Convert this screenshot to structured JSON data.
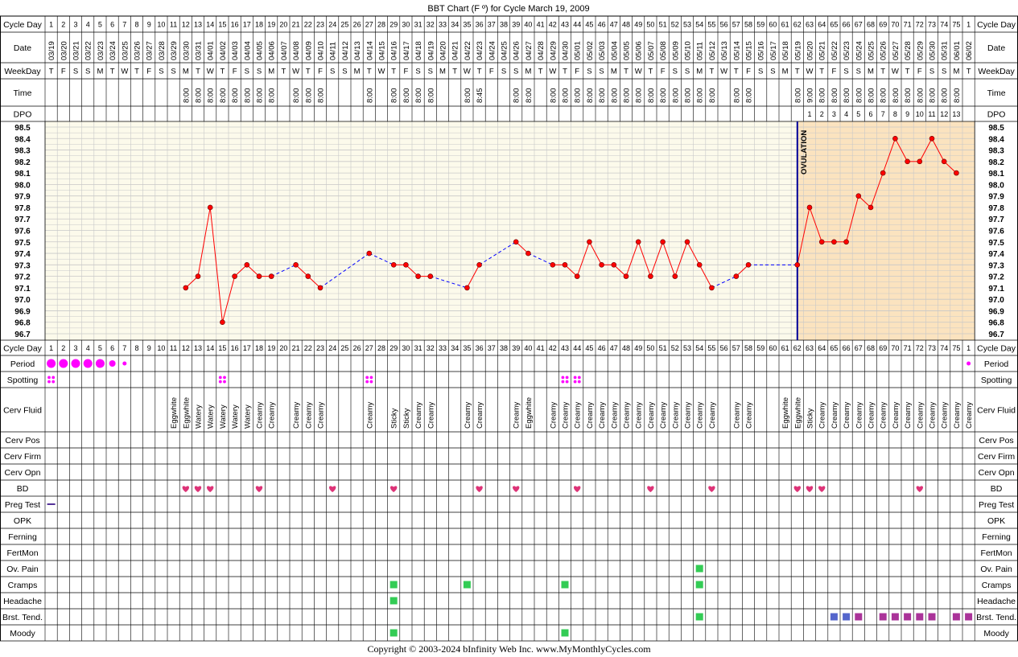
{
  "title": "BBT Chart (F º) for Cycle March 19, 2009",
  "footer": "Copyright © 2003-2024 bInfinity Web Inc.     www.MyMonthlyCycles.com",
  "row_labels": {
    "cycle_day": "Cycle Day",
    "date": "Date",
    "weekday": "WeekDay",
    "time": "Time",
    "dpo": "DPO",
    "period": "Period",
    "spotting": "Spotting",
    "cerv_fluid": "Cerv Fluid",
    "cerv_pos": "Cerv Pos",
    "cerv_firm": "Cerv Firm",
    "cerv_opn": "Cerv Opn",
    "bd": "BD",
    "preg_test": "Preg Test",
    "opk": "OPK",
    "ferning": "Ferning",
    "fertmon": "FertMon",
    "ov_pain": "Ov. Pain",
    "cramps": "Cramps",
    "headache": "Headache",
    "brst_tend": "Brst. Tend.",
    "moody": "Moody"
  },
  "ovulation_label": "OVULATION",
  "colors": {
    "line": "#ff0000",
    "point": "#ff0000",
    "dashed": "#0000ff",
    "ovulation": "#000099",
    "period": "#ff00ff",
    "bd": "#dd3377",
    "green": "#33cc55",
    "blue": "#5566cc",
    "purple": "#aa3399",
    "bg_pre": "#fcfaeb",
    "bg_post": "#fbe3bf",
    "grid": "#c8c8c8"
  },
  "chart_data": {
    "type": "line",
    "title": "BBT Chart (F º) for Cycle March 19, 2009",
    "ylim": [
      96.7,
      98.5
    ],
    "y_ticks": [
      "98.5",
      "98.4",
      "98.3",
      "98.2",
      "98.1",
      "98.0",
      "97.9",
      "97.8",
      "97.7",
      "97.6",
      "97.5",
      "97.4",
      "97.3",
      "97.2",
      "97.1",
      "97.0",
      "96.9",
      "96.8",
      "96.7"
    ],
    "cycle_days": [
      1,
      2,
      3,
      4,
      5,
      6,
      7,
      8,
      9,
      10,
      11,
      12,
      13,
      14,
      15,
      16,
      17,
      18,
      19,
      20,
      21,
      22,
      23,
      24,
      25,
      26,
      27,
      28,
      29,
      30,
      31,
      32,
      33,
      34,
      35,
      36,
      37,
      38,
      39,
      40,
      41,
      42,
      43,
      44,
      45,
      46,
      47,
      48,
      49,
      50,
      51,
      52,
      53,
      54,
      55,
      56,
      57,
      58,
      59,
      60,
      61,
      62,
      63,
      64,
      65,
      66,
      67,
      68,
      69,
      70,
      71,
      72,
      73,
      74,
      75,
      1
    ],
    "dates": [
      "03/19",
      "03/20",
      "03/21",
      "03/22",
      "03/23",
      "03/24",
      "03/25",
      "03/26",
      "03/27",
      "03/28",
      "03/29",
      "03/30",
      "03/31",
      "04/01",
      "04/02",
      "04/03",
      "04/04",
      "04/05",
      "04/06",
      "04/07",
      "04/08",
      "04/09",
      "04/10",
      "04/11",
      "04/12",
      "04/13",
      "04/14",
      "04/15",
      "04/16",
      "04/17",
      "04/18",
      "04/19",
      "04/20",
      "04/21",
      "04/22",
      "04/23",
      "04/24",
      "04/25",
      "04/26",
      "04/27",
      "04/28",
      "04/29",
      "04/30",
      "05/01",
      "05/02",
      "05/03",
      "05/04",
      "05/05",
      "05/06",
      "05/07",
      "05/08",
      "05/09",
      "05/10",
      "05/11",
      "05/12",
      "05/13",
      "05/14",
      "05/15",
      "05/16",
      "05/17",
      "05/18",
      "05/19",
      "05/20",
      "05/21",
      "05/22",
      "05/23",
      "05/24",
      "05/25",
      "05/26",
      "05/27",
      "05/28",
      "05/29",
      "05/30",
      "05/31",
      "06/01",
      "06/02"
    ],
    "weekdays": [
      "T",
      "F",
      "S",
      "S",
      "M",
      "T",
      "W",
      "T",
      "F",
      "S",
      "S",
      "M",
      "T",
      "W",
      "T",
      "F",
      "S",
      "S",
      "M",
      "T",
      "W",
      "T",
      "F",
      "S",
      "S",
      "M",
      "T",
      "W",
      "T",
      "F",
      "S",
      "S",
      "M",
      "T",
      "W",
      "T",
      "F",
      "S",
      "S",
      "M",
      "T",
      "W",
      "T",
      "F",
      "S",
      "S",
      "M",
      "T",
      "W",
      "T",
      "F",
      "S",
      "S",
      "M",
      "T",
      "W",
      "T",
      "F",
      "S",
      "S",
      "M",
      "T",
      "W",
      "T",
      "F",
      "S",
      "S",
      "M",
      "T",
      "W",
      "T",
      "F",
      "S",
      "S",
      "M",
      "T"
    ],
    "times": [
      "",
      "",
      "",
      "",
      "",
      "",
      "",
      "",
      "",
      "",
      "",
      "8:00",
      "8:00",
      "8:00",
      "8:00",
      "8:00",
      "8:00",
      "8:00",
      "8:00",
      "",
      "8:00",
      "8:00",
      "8:00",
      "",
      "",
      "",
      "8:00",
      "",
      "8:00",
      "8:00",
      "8:00",
      "8:00",
      "",
      "",
      "8:00",
      "8:45",
      "",
      "",
      "8:00",
      "8:00",
      "",
      "8:00",
      "8:00",
      "8:00",
      "8:00",
      "8:00",
      "8:00",
      "8:00",
      "8:00",
      "8:00",
      "8:00",
      "8:00",
      "8:00",
      "8:00",
      "8:00",
      "",
      "8:00",
      "8:00",
      "",
      "",
      "",
      "8:00",
      "9:00",
      "8:00",
      "8:00",
      "8:00",
      "8:00",
      "8:00",
      "8:00",
      "8:00",
      "8:00",
      "8:00",
      "8:00",
      "8:00",
      "8:00",
      ""
    ],
    "dpo": [
      "",
      "",
      "",
      "",
      "",
      "",
      "",
      "",
      "",
      "",
      "",
      "",
      "",
      "",
      "",
      "",
      "",
      "",
      "",
      "",
      "",
      "",
      "",
      "",
      "",
      "",
      "",
      "",
      "",
      "",
      "",
      "",
      "",
      "",
      "",
      "",
      "",
      "",
      "",
      "",
      "",
      "",
      "",
      "",
      "",
      "",
      "",
      "",
      "",
      "",
      "",
      "",
      "",
      "",
      "",
      "",
      "",
      "",
      "",
      "",
      "",
      "",
      "1",
      "2",
      "3",
      "4",
      "5",
      "6",
      "7",
      "8",
      "9",
      "10",
      "11",
      "12",
      "13",
      ""
    ],
    "temperatures": [
      null,
      null,
      null,
      null,
      null,
      null,
      null,
      null,
      null,
      null,
      null,
      97.1,
      97.2,
      97.8,
      96.8,
      97.2,
      97.3,
      97.2,
      97.2,
      null,
      97.3,
      97.2,
      97.1,
      null,
      null,
      null,
      97.4,
      null,
      97.3,
      97.3,
      97.2,
      97.2,
      null,
      null,
      97.1,
      97.3,
      null,
      null,
      97.5,
      97.4,
      null,
      97.3,
      97.3,
      97.2,
      97.5,
      97.3,
      97.3,
      97.2,
      97.5,
      97.2,
      97.5,
      97.2,
      97.5,
      97.3,
      97.1,
      null,
      97.2,
      97.3,
      null,
      null,
      null,
      97.3,
      97.8,
      97.5,
      97.5,
      97.5,
      97.9,
      97.8,
      98.1,
      98.4,
      98.2,
      98.2,
      98.4,
      98.2,
      98.1,
      null
    ],
    "ovulation_day_index": 61,
    "period": [
      "big",
      "big",
      "big",
      "big",
      "big",
      "med",
      "small",
      "",
      "",
      "",
      "",
      "",
      "",
      "",
      "",
      "",
      "",
      "",
      "",
      "",
      "",
      "",
      "",
      "",
      "",
      "",
      "",
      "",
      "",
      "",
      "",
      "",
      "",
      "",
      "",
      "",
      "",
      "",
      "",
      "",
      "",
      "",
      "",
      "",
      "",
      "",
      "",
      "",
      "",
      "",
      "",
      "",
      "",
      "",
      "",
      "",
      "",
      "",
      "",
      "",
      "",
      "",
      "",
      "",
      "",
      "",
      "",
      "",
      "",
      "",
      "",
      "",
      "",
      "",
      "",
      "small"
    ],
    "spotting": [
      0,
      14,
      26,
      42,
      43
    ],
    "cerv_fluid": [
      "",
      "",
      "",
      "",
      "",
      "",
      "",
      "",
      "",
      "",
      "",
      "",
      "",
      "",
      "",
      "",
      "",
      "",
      "",
      "",
      "",
      "",
      "",
      "",
      "",
      "",
      "",
      "",
      "",
      "",
      "",
      "",
      "",
      "",
      "",
      "",
      "",
      "",
      "",
      "",
      "",
      "",
      "",
      "",
      "",
      "",
      "",
      "",
      "",
      "",
      "",
      "",
      "",
      "",
      "",
      "",
      "",
      "",
      "",
      "",
      "",
      "",
      "",
      "",
      "",
      "",
      "",
      "",
      "",
      "",
      "",
      "",
      "",
      "",
      "",
      ""
    ],
    "cerv_fluid_entries": {
      "10": "Eggwhite",
      "11": "Eggwhite",
      "12": "Watery",
      "13": "Watery",
      "14": "Watery",
      "15": "Watery",
      "16": "Watery",
      "17": "Creamy",
      "18": "Creamy",
      "20": "Creamy",
      "21": "Creamy",
      "22": "Creamy",
      "26": "Creamy",
      "28": "Sticky",
      "29": "Sticky",
      "30": "Creamy",
      "31": "Creamy",
      "34": "Creamy",
      "35": "Creamy",
      "38": "Creamy",
      "39": "Eggwhite",
      "41": "Creamy",
      "42": "Creamy",
      "43": "Creamy",
      "44": "Creamy",
      "45": "Creamy",
      "46": "Creamy",
      "47": "Creamy",
      "48": "Creamy",
      "49": "Creamy",
      "50": "Creamy",
      "51": "Creamy",
      "52": "Creamy",
      "53": "Creamy",
      "54": "Creamy",
      "56": "Creamy",
      "57": "Creamy",
      "60": "Eggwhite",
      "61": "Eggwhite",
      "62": "Sticky",
      "63": "Creamy",
      "64": "Creamy",
      "65": "Creamy",
      "66": "Creamy",
      "67": "Creamy",
      "68": "Creamy",
      "69": "Creamy",
      "70": "Creamy",
      "71": "Creamy",
      "72": "Creamy",
      "73": "Creamy",
      "74": "Creamy",
      "75": "Creamy"
    },
    "bd": [
      11,
      12,
      13,
      17,
      23,
      28,
      35,
      38,
      43,
      49,
      54,
      61,
      62,
      63,
      71
    ],
    "preg_test": [
      0
    ],
    "ov_pain": [
      53
    ],
    "cramps": [
      28,
      34,
      42,
      53
    ],
    "headache": [
      28
    ],
    "brst_tend": {
      "64": "blue",
      "65": "blue",
      "66": "purple",
      "68": "purple",
      "69": "purple",
      "70": "purple",
      "71": "purple",
      "72": "purple",
      "74": "purple",
      "75": "purple"
    },
    "moody": [
      28,
      42
    ]
  }
}
